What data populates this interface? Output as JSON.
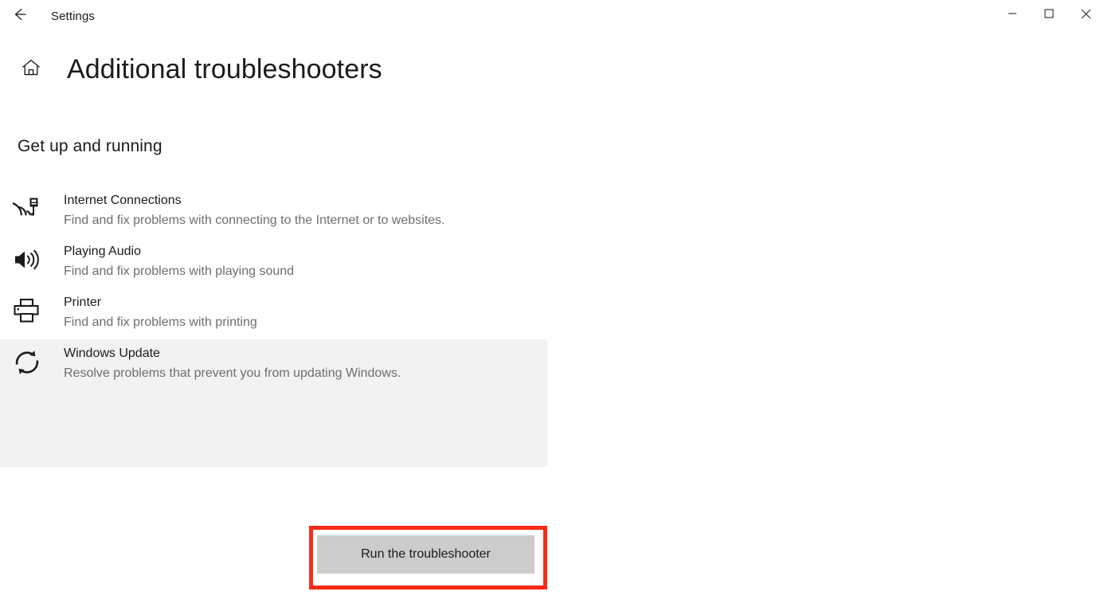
{
  "window": {
    "app_title": "Settings",
    "back_icon": "back-arrow-icon",
    "controls": {
      "minimize_label": "Minimize",
      "maximize_label": "Maximize",
      "close_label": "Close"
    }
  },
  "page": {
    "home_icon": "home-icon",
    "title": "Additional troubleshooters",
    "section_heading": "Get up and running"
  },
  "troubleshooters": [
    {
      "icon": "wifi-network-icon",
      "name": "Internet Connections",
      "description": "Find and fix problems with connecting to the Internet or to websites.",
      "selected": false
    },
    {
      "icon": "speaker-audio-icon",
      "name": "Playing Audio",
      "description": "Find and fix problems with playing sound",
      "selected": false
    },
    {
      "icon": "printer-icon",
      "name": "Printer",
      "description": "Find and fix problems with printing",
      "selected": false
    },
    {
      "icon": "refresh-sync-icon",
      "name": "Windows Update",
      "description": "Resolve problems that prevent you from updating Windows.",
      "selected": true
    }
  ],
  "action": {
    "run_button_label": "Run the troubleshooter",
    "highlight_color": "#fa2a15",
    "button_bg_color": "#cccccc",
    "selected_row_bg": "#f2f2f2"
  }
}
